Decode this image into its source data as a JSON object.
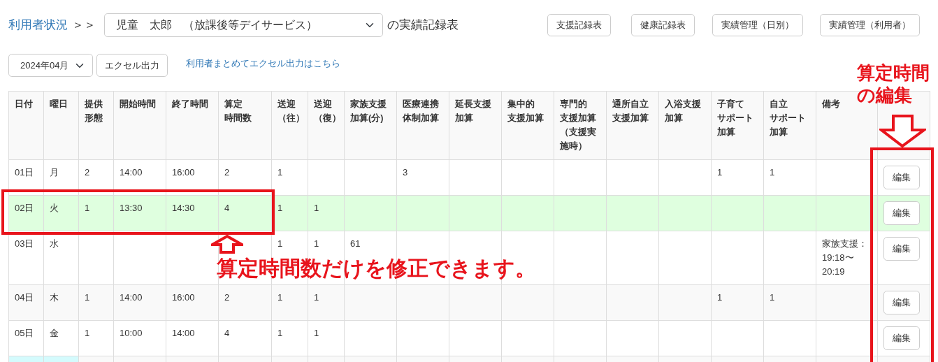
{
  "header": {
    "breadcrumb_link": "利用者状況",
    "separator": "＞＞",
    "user_select": {
      "value": "児童　太郎　（放課後等デイサービス）"
    },
    "title_suffix": "の実績記録表",
    "nav_buttons": [
      "支援記録表",
      "健康記録表",
      "実績管理（日別）",
      "実績管理（利用者）"
    ]
  },
  "toolbar": {
    "month_select": {
      "value": "2024年04月"
    },
    "export_button": "エクセル出力",
    "bulk_export_link": "利用者まとめてエクセル出力はこちら"
  },
  "table": {
    "columns": [
      [
        "日付"
      ],
      [
        "曜日"
      ],
      [
        "提供",
        "形態"
      ],
      [
        "開始時間"
      ],
      [
        "終了時間"
      ],
      [
        "算定",
        "時間数"
      ],
      [
        "送迎",
        "（往）"
      ],
      [
        "送迎",
        "（復）"
      ],
      [
        "家族支援",
        "加算(分)"
      ],
      [
        "医療連携",
        "体制加算"
      ],
      [
        "延長支援",
        "加算"
      ],
      [
        "集中的",
        "支援加算"
      ],
      [
        "専門的",
        "支援加算",
        "（支援実",
        "施時）"
      ],
      [
        "通所自立",
        "支援加算"
      ],
      [
        "入浴支援",
        "加算"
      ],
      [
        "子育て",
        "サポート",
        "加算"
      ],
      [
        "自立",
        "サポート",
        "加算"
      ],
      [
        "備考"
      ]
    ],
    "rows": [
      {
        "kind": "day",
        "highlighted": false,
        "date_highlight": false,
        "cells": [
          "01日",
          "月",
          "2",
          "14:00",
          "16:00",
          "2",
          "1",
          null,
          null,
          "3",
          null,
          null,
          null,
          null,
          null,
          "1",
          "1",
          null
        ],
        "edit_button": "編集"
      },
      {
        "kind": "day",
        "highlighted": true,
        "date_highlight": false,
        "cells": [
          "02日",
          "火",
          "1",
          "13:30",
          "14:30",
          "4",
          "1",
          "1",
          null,
          null,
          null,
          null,
          null,
          null,
          null,
          null,
          null,
          null
        ],
        "edit_button": "編集"
      },
      {
        "kind": "day",
        "highlighted": false,
        "date_highlight": false,
        "cells": [
          "03日",
          "水",
          null,
          null,
          null,
          null,
          "1",
          "1",
          "61",
          null,
          null,
          null,
          null,
          null,
          null,
          null,
          null,
          [
            "家族支援：",
            "19:18〜",
            "20:19"
          ]
        ],
        "edit_button": "編集"
      },
      {
        "kind": "day",
        "highlighted": false,
        "date_highlight": false,
        "cells": [
          "04日",
          "木",
          "1",
          "14:00",
          "16:00",
          "2",
          "1",
          "1",
          null,
          null,
          null,
          null,
          null,
          null,
          null,
          "1",
          "1",
          null
        ],
        "edit_button": "編集"
      },
      {
        "kind": "day",
        "highlighted": false,
        "date_highlight": false,
        "cells": [
          "05日",
          "金",
          "1",
          "10:00",
          "14:00",
          "4",
          "1",
          "1",
          null,
          null,
          null,
          null,
          null,
          null,
          null,
          null,
          null,
          null
        ],
        "edit_button": "編集"
      },
      {
        "kind": "cut",
        "highlighted": false,
        "date_highlight": true
      }
    ]
  },
  "annotations": [
    {
      "kind": "note",
      "lines": [
        "算定時間数だけを修正できます。"
      ]
    },
    {
      "kind": "note",
      "lines": [
        "算定時間",
        "の編集"
      ]
    }
  ]
}
